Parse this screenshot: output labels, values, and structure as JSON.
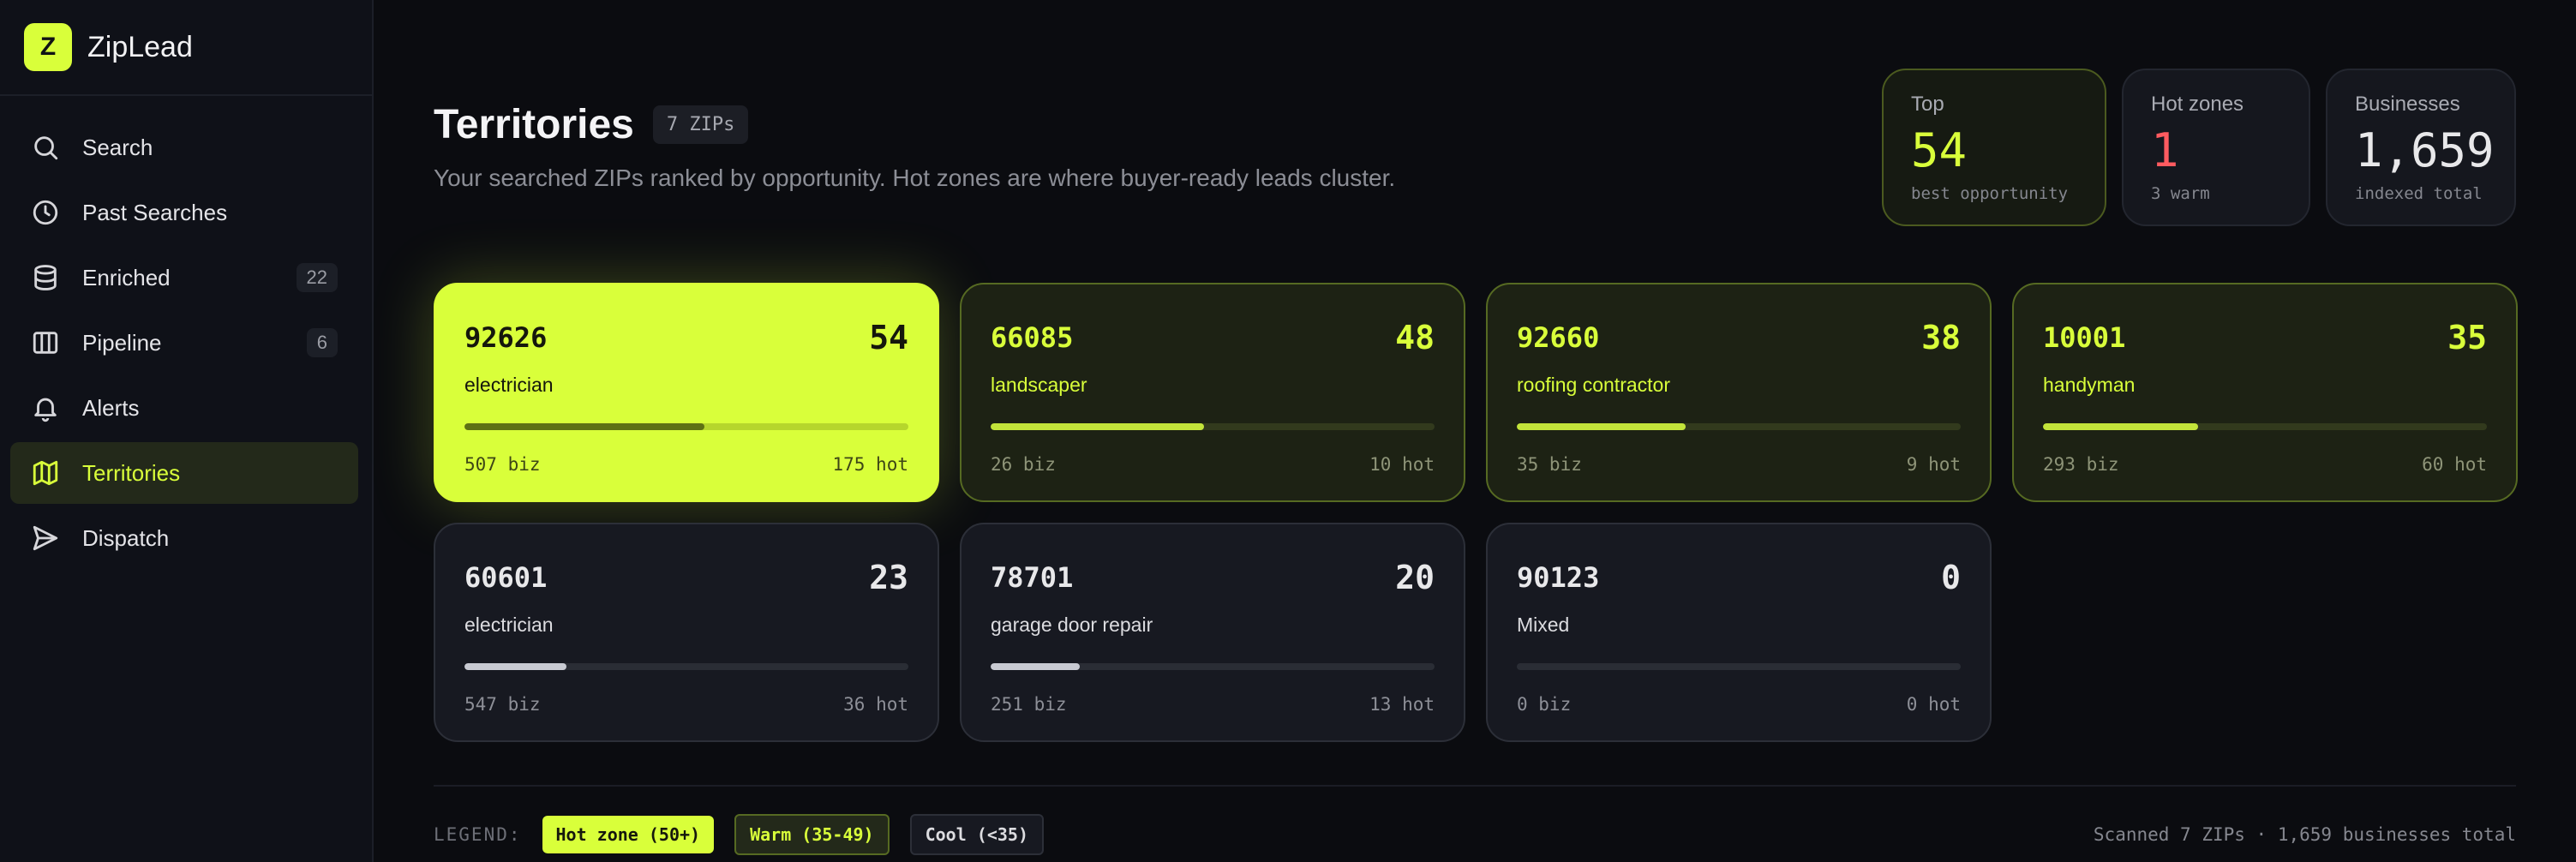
{
  "brand": {
    "logo_letter": "Z",
    "name": "ZipLead"
  },
  "sidebar": {
    "items": [
      {
        "label": "Search",
        "icon": "search-icon",
        "count": null,
        "active": false
      },
      {
        "label": "Past Searches",
        "icon": "clock-icon",
        "count": null,
        "active": false
      },
      {
        "label": "Enriched",
        "icon": "database-icon",
        "count": "22",
        "active": false
      },
      {
        "label": "Pipeline",
        "icon": "columns-icon",
        "count": "6",
        "active": false
      },
      {
        "label": "Alerts",
        "icon": "bell-icon",
        "count": null,
        "active": false
      },
      {
        "label": "Territories",
        "icon": "map-icon",
        "count": null,
        "active": true
      },
      {
        "label": "Dispatch",
        "icon": "send-icon",
        "count": null,
        "active": false
      }
    ]
  },
  "header": {
    "title": "Territories",
    "zip_badge": "7 ZIPs",
    "subtitle": "Your searched ZIPs ranked by opportunity. Hot zones are where buyer-ready leads cluster."
  },
  "stats": {
    "top": {
      "label": "Top",
      "value": "54",
      "sub": "best opportunity"
    },
    "hot": {
      "label": "Hot zones",
      "value": "1",
      "sub": "3 warm"
    },
    "businesses": {
      "label": "Businesses",
      "value": "1,659",
      "sub": "indexed total"
    }
  },
  "territories": [
    {
      "zip": "92626",
      "score": "54",
      "trade": "electrician",
      "biz": "507 biz",
      "hot": "175 hot",
      "tier": "hotzone",
      "fill": 0.54
    },
    {
      "zip": "66085",
      "score": "48",
      "trade": "landscaper",
      "biz": "26 biz",
      "hot": "10 hot",
      "tier": "warm",
      "fill": 0.48
    },
    {
      "zip": "92660",
      "score": "38",
      "trade": "roofing contractor",
      "biz": "35 biz",
      "hot": "9 hot",
      "tier": "warm",
      "fill": 0.38
    },
    {
      "zip": "10001",
      "score": "35",
      "trade": "handyman",
      "biz": "293 biz",
      "hot": "60 hot",
      "tier": "warm",
      "fill": 0.35
    },
    {
      "zip": "60601",
      "score": "23",
      "trade": "electrician",
      "biz": "547 biz",
      "hot": "36 hot",
      "tier": "cool",
      "fill": 0.23
    },
    {
      "zip": "78701",
      "score": "20",
      "trade": "garage door repair",
      "biz": "251 biz",
      "hot": "13 hot",
      "tier": "cool",
      "fill": 0.2
    },
    {
      "zip": "90123",
      "score": "0",
      "trade": "Mixed",
      "biz": "0 biz",
      "hot": "0 hot",
      "tier": "cool",
      "fill": 0
    }
  ],
  "legend": {
    "label": "LEGEND:",
    "hot": "Hot zone (50+)",
    "warm": "Warm (35-49)",
    "cool": "Cool (<35)"
  },
  "footer": {
    "summary": "Scanned 7 ZIPs · 1,659 businesses total"
  },
  "colors": {
    "accent": "#d9ff3a",
    "hot_value": "#ff5b60",
    "background": "#0b0c10"
  }
}
